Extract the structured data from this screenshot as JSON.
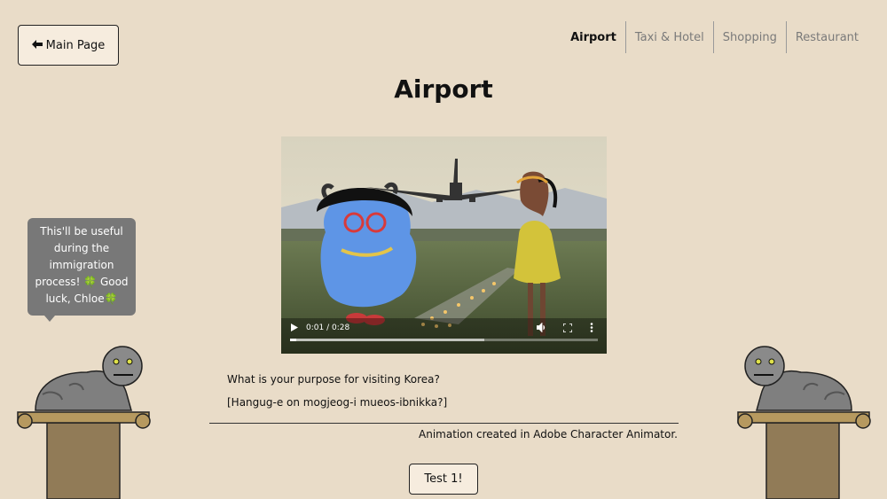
{
  "header": {
    "main_page_label": "Main Page",
    "page_title": "Airport"
  },
  "nav": {
    "items": [
      "Airport",
      "Taxi & Hotel",
      "Shopping",
      "Restaurant"
    ],
    "active": "Airport"
  },
  "bubble": {
    "text": "This'll be useful during the immigration process! 🍀 Good luck, Chloe🍀"
  },
  "video": {
    "current_time": "0:01",
    "duration": "0:28",
    "time_display": "0:01 / 0:28",
    "progress": 0.02,
    "buffered": 0.63
  },
  "dialogue": {
    "question": "What is your purpose for visiting Korea?",
    "romanized": "[Hangug-e on mogjeog-i mueos-ibnikka?]"
  },
  "caption": "Animation created in Adobe Character Animator.",
  "test_button_label": "Test 1!",
  "colors": {
    "background": "#e9dcc8",
    "button_bg": "#f6ecde",
    "bubble_bg": "#787878"
  }
}
